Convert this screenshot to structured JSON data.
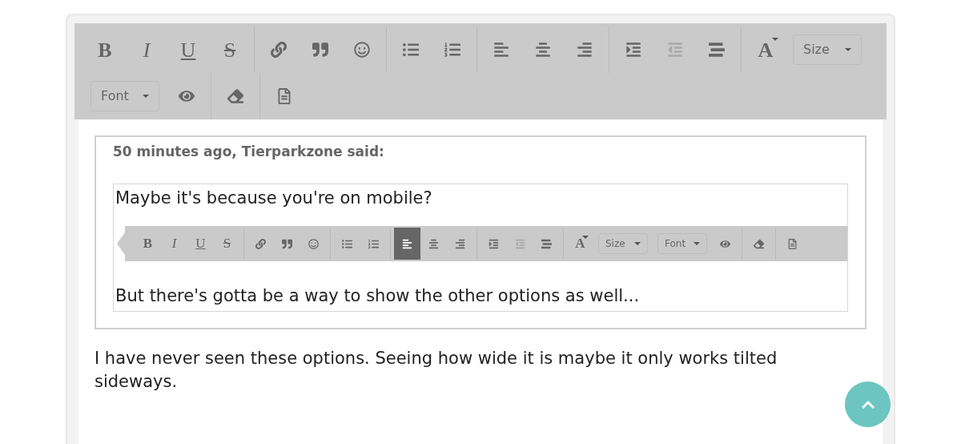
{
  "editor_toolbar": {
    "rows": [
      {
        "groups": [
          [
            {
              "kind": "letter",
              "label": "B",
              "disabled": false
            },
            {
              "kind": "letter",
              "label": "I",
              "disabled": false
            },
            {
              "kind": "letter",
              "label": "U",
              "disabled": false
            },
            {
              "kind": "letter",
              "label": "S",
              "disabled": false
            }
          ],
          [
            {
              "kind": "icon",
              "disabled": false
            },
            {
              "kind": "icon",
              "disabled": false
            },
            {
              "kind": "icon",
              "disabled": false
            }
          ],
          [
            {
              "kind": "icon",
              "disabled": false
            },
            {
              "kind": "icon",
              "disabled": false
            }
          ],
          [
            {
              "kind": "icon",
              "disabled": false
            },
            {
              "kind": "icon",
              "disabled": false
            },
            {
              "kind": "icon",
              "disabled": false
            }
          ],
          [
            {
              "kind": "icon",
              "disabled": false
            },
            {
              "kind": "icon",
              "disabled": true
            },
            {
              "kind": "icon",
              "disabled": false
            }
          ],
          [
            {
              "kind": "color",
              "label": "A",
              "disabled": false
            },
            {
              "kind": "dropdown",
              "label": "Size",
              "disabled": false
            }
          ]
        ]
      },
      {
        "groups": [
          [
            {
              "kind": "dropdown",
              "label": "Font",
              "disabled": false
            },
            {
              "kind": "icon",
              "disabled": false
            }
          ],
          [
            {
              "kind": "icon",
              "disabled": false
            }
          ],
          [
            {
              "kind": "icon",
              "disabled": false
            }
          ]
        ]
      }
    ]
  },
  "quote": {
    "attribution": "50 minutes ago, Tierparkzone said:",
    "embedded_post": {
      "first_line": "Maybe it's because you're on mobile?",
      "toolbar": {
        "groups": [
          [
            {
              "kind": "letter",
              "label": "B",
              "selected": false,
              "disabled": false
            },
            {
              "kind": "letter",
              "label": "I",
              "selected": false,
              "disabled": false
            },
            {
              "kind": "letter",
              "label": "U",
              "selected": false,
              "disabled": false
            },
            {
              "kind": "letter",
              "label": "S",
              "selected": false,
              "disabled": false
            }
          ],
          [
            {
              "kind": "icon",
              "selected": false,
              "disabled": false
            },
            {
              "kind": "icon",
              "selected": false,
              "disabled": false
            },
            {
              "kind": "icon",
              "selected": false,
              "disabled": false
            }
          ],
          [
            {
              "kind": "icon",
              "selected": false,
              "disabled": false
            },
            {
              "kind": "icon",
              "selected": false,
              "disabled": false
            }
          ],
          [
            {
              "kind": "icon",
              "selected": true,
              "disabled": false
            },
            {
              "kind": "icon",
              "selected": false,
              "disabled": false
            },
            {
              "kind": "icon",
              "selected": false,
              "disabled": false
            }
          ],
          [
            {
              "kind": "icon",
              "selected": false,
              "disabled": false
            },
            {
              "kind": "icon",
              "selected": false,
              "disabled": true
            },
            {
              "kind": "icon",
              "selected": false,
              "disabled": false
            }
          ],
          [
            {
              "kind": "color",
              "label": "A",
              "selected": false,
              "disabled": false
            },
            {
              "kind": "dropdown",
              "label": "Size",
              "selected": false,
              "disabled": false
            },
            {
              "kind": "dropdown",
              "label": "Font",
              "selected": false,
              "disabled": false
            },
            {
              "kind": "icon",
              "selected": false,
              "disabled": false
            }
          ],
          [
            {
              "kind": "icon",
              "selected": false,
              "disabled": false
            }
          ],
          [
            {
              "kind": "icon",
              "selected": false,
              "disabled": false
            }
          ]
        ]
      },
      "last_line": "But there's gotta be a way to show the other options as well..."
    }
  },
  "reply_text": "I have never seen these options. Seeing how wide it is maybe it only works tilted sideways."
}
